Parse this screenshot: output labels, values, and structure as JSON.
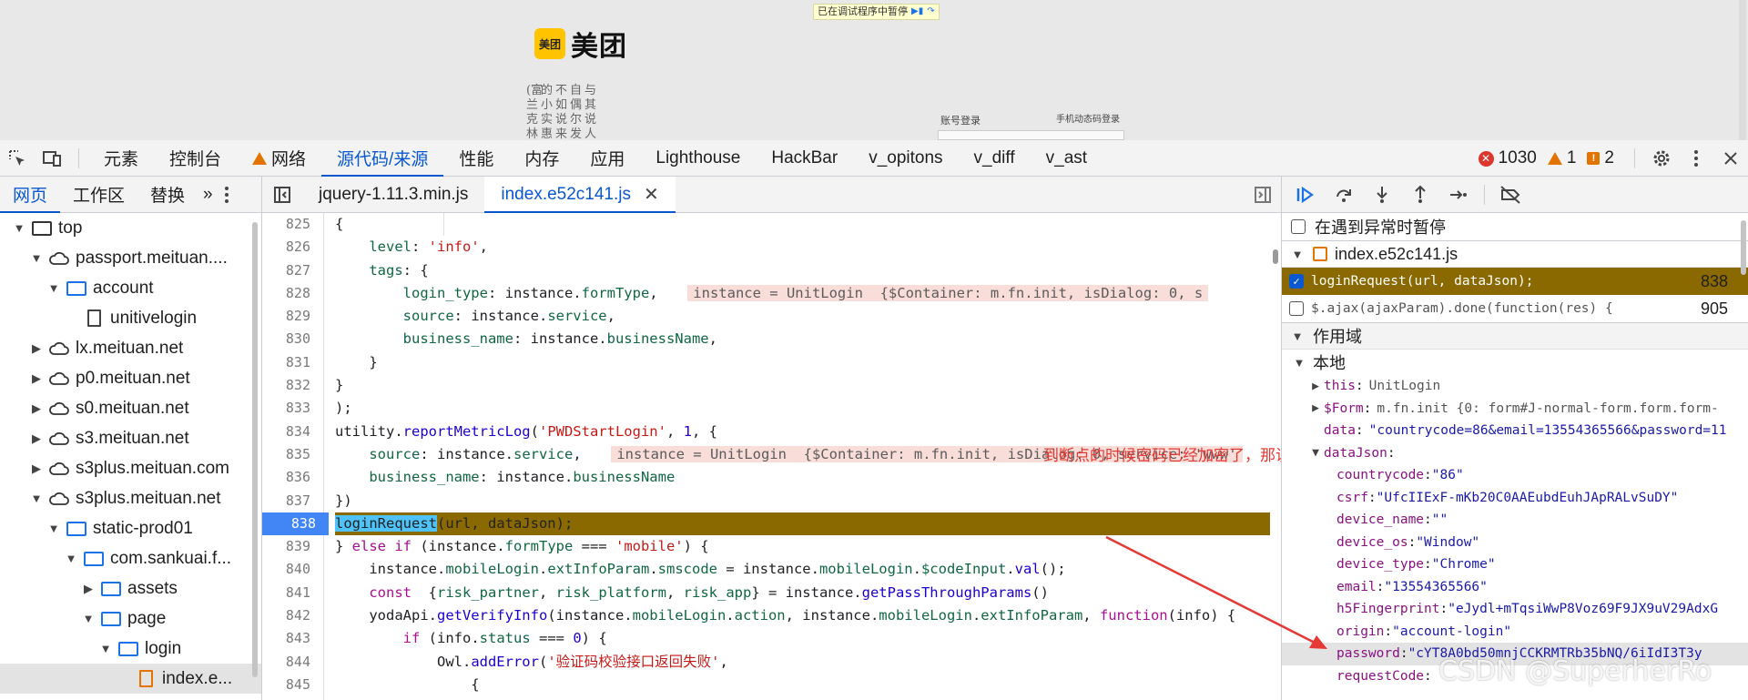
{
  "preview": {
    "pause_banner": "已在调试程序中暂停",
    "logo_mark": "美团",
    "logo_word": "美团",
    "vertical_text": [
      "与其说人",
      "自偶尔发",
      "不如说来",
      "的小实惠",
      "(富兰克林"
    ],
    "login_tab_account": "账号登录",
    "login_tab_mobile": "手机动态码登录"
  },
  "toolbar": {
    "tabs": [
      "元素",
      "控制台",
      "网络",
      "源代码/来源",
      "性能",
      "内存",
      "应用",
      "Lighthouse",
      "HackBar",
      "v_opitons",
      "v_diff",
      "v_ast"
    ],
    "active_tab": "源代码/来源",
    "errors": "1030",
    "warnings": "1",
    "issues": "2"
  },
  "navigator": {
    "tabs": [
      "网页",
      "工作区",
      "替换"
    ],
    "tree": [
      {
        "label": "top",
        "icon": "frame-icon",
        "twisty": "▼",
        "depth": 0
      },
      {
        "label": "passport.meituan....",
        "icon": "cloud-icon",
        "twisty": "▼",
        "depth": 1
      },
      {
        "label": "account",
        "icon": "folder-icon",
        "twisty": "▼",
        "depth": 2
      },
      {
        "label": "unitivelogin",
        "icon": "file-icon",
        "twisty": "",
        "depth": 3
      },
      {
        "label": "lx.meituan.net",
        "icon": "cloud-icon",
        "twisty": "▶",
        "depth": 1
      },
      {
        "label": "p0.meituan.net",
        "icon": "cloud-icon",
        "twisty": "▶",
        "depth": 1
      },
      {
        "label": "s0.meituan.net",
        "icon": "cloud-icon",
        "twisty": "▶",
        "depth": 1
      },
      {
        "label": "s3.meituan.net",
        "icon": "cloud-icon",
        "twisty": "▶",
        "depth": 1
      },
      {
        "label": "s3plus.meituan.com",
        "icon": "cloud-icon",
        "twisty": "▶",
        "depth": 1
      },
      {
        "label": "s3plus.meituan.net",
        "icon": "cloud-icon",
        "twisty": "▼",
        "depth": 1
      },
      {
        "label": "static-prod01",
        "icon": "folder-icon",
        "twisty": "▼",
        "depth": 2
      },
      {
        "label": "com.sankuai.f...",
        "icon": "folder-icon",
        "twisty": "▼",
        "depth": 3
      },
      {
        "label": "assets",
        "icon": "folder-icon",
        "twisty": "▶",
        "depth": 4
      },
      {
        "label": "page",
        "icon": "folder-icon",
        "twisty": "▼",
        "depth": 4
      },
      {
        "label": "login",
        "icon": "folder-icon",
        "twisty": "▼",
        "depth": 5
      },
      {
        "label": "index.e...",
        "icon": "js-file-icon",
        "twisty": "",
        "depth": 6,
        "selected": true
      }
    ]
  },
  "editor": {
    "tabs": [
      "jquery-1.11.3.min.js",
      "index.e52c141.js"
    ],
    "active_tab": "index.e52c141.js",
    "paused_line": 838,
    "annotation": "到断点的时候密码已经加密了，那说明加密操作在断点前面"
  },
  "debugger": {
    "pause_on_exceptions": "在遇到异常时暂停",
    "breakpoints_file": "index.e52c141.js",
    "breakpoints": [
      {
        "code": "loginRequest(url, dataJson);",
        "line": "838",
        "checked": true
      },
      {
        "code": "$.ajax(ajaxParam).done(function(res) {",
        "line": "905",
        "checked": false
      }
    ],
    "scope_title": "作用域",
    "local_title": "本地",
    "scope": {
      "this_key": "this",
      "this_val": "UnitLogin",
      "form_key": "$Form",
      "form_val": "m.fn.init  {0: form#J-normal-form.form.form-",
      "data_key": "data",
      "data_val": "\"countrycode=86&email=13554365566&password=11",
      "dataJson_key": "dataJson",
      "fields": [
        {
          "key": "countrycode",
          "val": "\"86\""
        },
        {
          "key": "csrf",
          "val": "\"UfcIIExF-mKb20C0AAEubdEuhJApRALvSuDY\""
        },
        {
          "key": "device_name",
          "val": "\"\""
        },
        {
          "key": "device_os",
          "val": "\"Window\""
        },
        {
          "key": "device_type",
          "val": "\"Chrome\""
        },
        {
          "key": "email",
          "val": "\"13554365566\""
        },
        {
          "key": "h5Fingerprint",
          "val": "\"eJydl+mTqsiWwP8Voz69F9JX9uV29AdxG"
        },
        {
          "key": "origin",
          "val": "\"account-login\""
        },
        {
          "key": "password",
          "val": "\"cYT8A0bd50mnjCCKRMTRb35bNQ/6iIdI3T3y"
        },
        {
          "key": "requestCode",
          "val": ""
        }
      ]
    }
  },
  "watermark": "CSDN @SuperherRo"
}
